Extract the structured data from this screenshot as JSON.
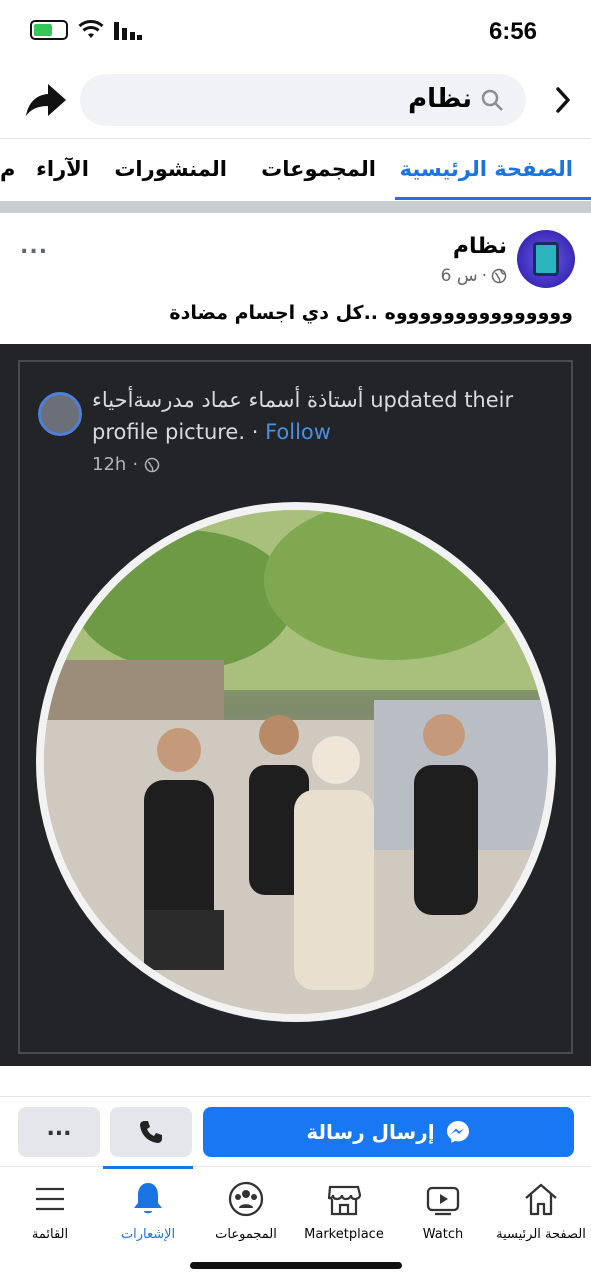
{
  "status_bar": {
    "time": "6:56"
  },
  "search": {
    "query": "نظام"
  },
  "tabs": [
    {
      "label": "الصفحة الرئيسية",
      "active": true
    },
    {
      "label": "المجموعات"
    },
    {
      "label": "المنشورات"
    },
    {
      "label": "الآراء"
    },
    {
      "label": "م"
    }
  ],
  "post": {
    "page_name": "نظام",
    "time": "6 س",
    "text": "وووووووووووووووه ..كل دي اجسام مضادة",
    "shared": {
      "actor": "أستاذة أسماء عماد مدرسةأحياء",
      "action": "updated their",
      "action2": "profile picture.",
      "follow": "Follow",
      "time": "12h"
    }
  },
  "actions": {
    "more_label": "...",
    "message_label": "إرسال رسالة"
  },
  "bottom_nav": [
    {
      "label": "الصفحة الرئيسية",
      "icon": "home-icon"
    },
    {
      "label": "Watch",
      "icon": "watch-icon"
    },
    {
      "label": "Marketplace",
      "icon": "marketplace-icon"
    },
    {
      "label": "المجموعات",
      "icon": "groups-icon"
    },
    {
      "label": "الإشعارات",
      "icon": "bell-icon",
      "active": true
    },
    {
      "label": "القائمة",
      "icon": "menu-icon"
    }
  ],
  "colors": {
    "brand": "#1877f2",
    "tab_active": "#1b74e4"
  }
}
